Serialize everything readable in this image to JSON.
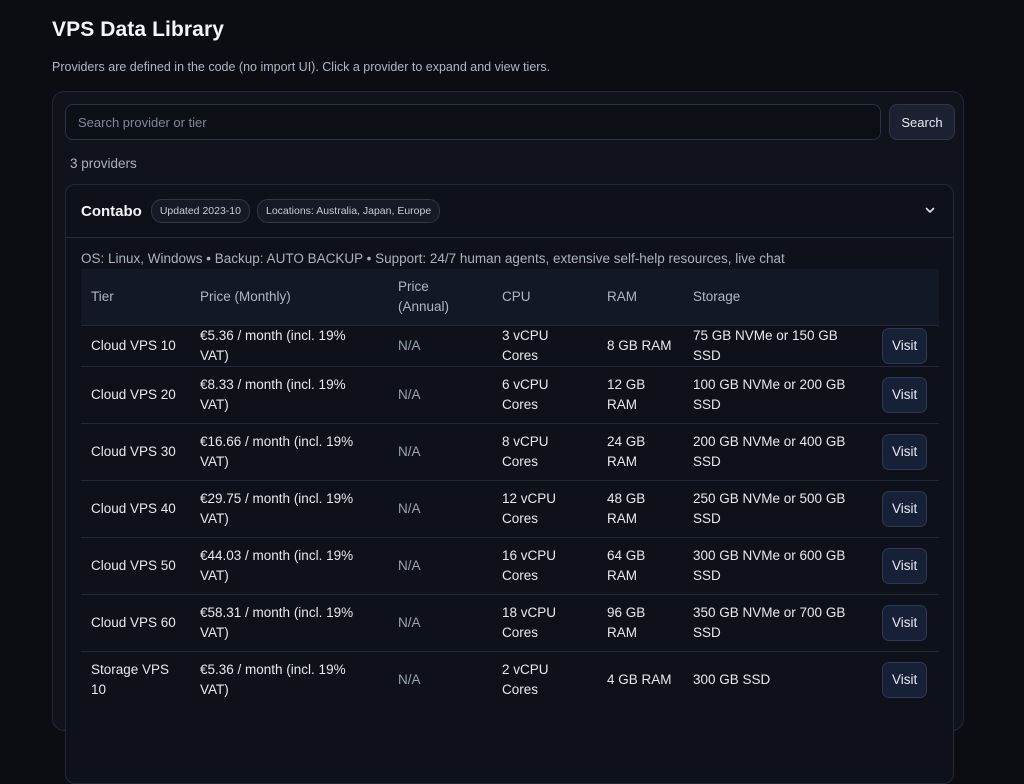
{
  "page": {
    "title": "VPS Data Library",
    "subtitle": "Providers are defined in the code (no import UI). Click a provider to expand and view tiers."
  },
  "search": {
    "placeholder": "Search provider or tier",
    "value": "",
    "button_label": "Search"
  },
  "provider_count": "3 providers",
  "provider": {
    "name": "Contabo",
    "updated": "Updated 2023-10",
    "locations": "Locations: Australia, Japan, Europe",
    "meta": "OS: Linux, Windows • Backup: AUTO BACKUP • Support: 24/7 human agents, extensive self-help resources, live chat",
    "columns": [
      "Tier",
      "Price (Monthly)",
      "Price (Annual)",
      "CPU",
      "RAM",
      "Storage",
      ""
    ],
    "visit_label": "Visit",
    "tiers": [
      {
        "tier": "Cloud VPS 10",
        "monthly": "€5.36 / month (incl. 19% VAT)",
        "annual": "N/A",
        "cpu": "3 vCPU Cores",
        "ram": "8 GB RAM",
        "storage": "75 GB NVMe or 150 GB SSD"
      },
      {
        "tier": "Cloud VPS 20",
        "monthly": "€8.33 / month (incl. 19% VAT)",
        "annual": "N/A",
        "cpu": "6 vCPU Cores",
        "ram": "12 GB RAM",
        "storage": "100 GB NVMe or 200 GB SSD"
      },
      {
        "tier": "Cloud VPS 30",
        "monthly": "€16.66 / month (incl. 19% VAT)",
        "annual": "N/A",
        "cpu": "8 vCPU Cores",
        "ram": "24 GB RAM",
        "storage": "200 GB NVMe or 400 GB SSD"
      },
      {
        "tier": "Cloud VPS 40",
        "monthly": "€29.75 / month (incl. 19% VAT)",
        "annual": "N/A",
        "cpu": "12 vCPU Cores",
        "ram": "48 GB RAM",
        "storage": "250 GB NVMe or 500 GB SSD"
      },
      {
        "tier": "Cloud VPS 50",
        "monthly": "€44.03 / month (incl. 19% VAT)",
        "annual": "N/A",
        "cpu": "16 vCPU Cores",
        "ram": "64 GB RAM",
        "storage": "300 GB NVMe or 600 GB SSD"
      },
      {
        "tier": "Cloud VPS 60",
        "monthly": "€58.31 / month (incl. 19% VAT)",
        "annual": "N/A",
        "cpu": "18 vCPU Cores",
        "ram": "96 GB RAM",
        "storage": "350 GB NVMe or 700 GB SSD"
      },
      {
        "tier": "Storage VPS 10",
        "monthly": "€5.36 / month (incl. 19% VAT)",
        "annual": "N/A",
        "cpu": "2 vCPU Cores",
        "ram": "4 GB RAM",
        "storage": "300 GB SSD"
      }
    ]
  }
}
